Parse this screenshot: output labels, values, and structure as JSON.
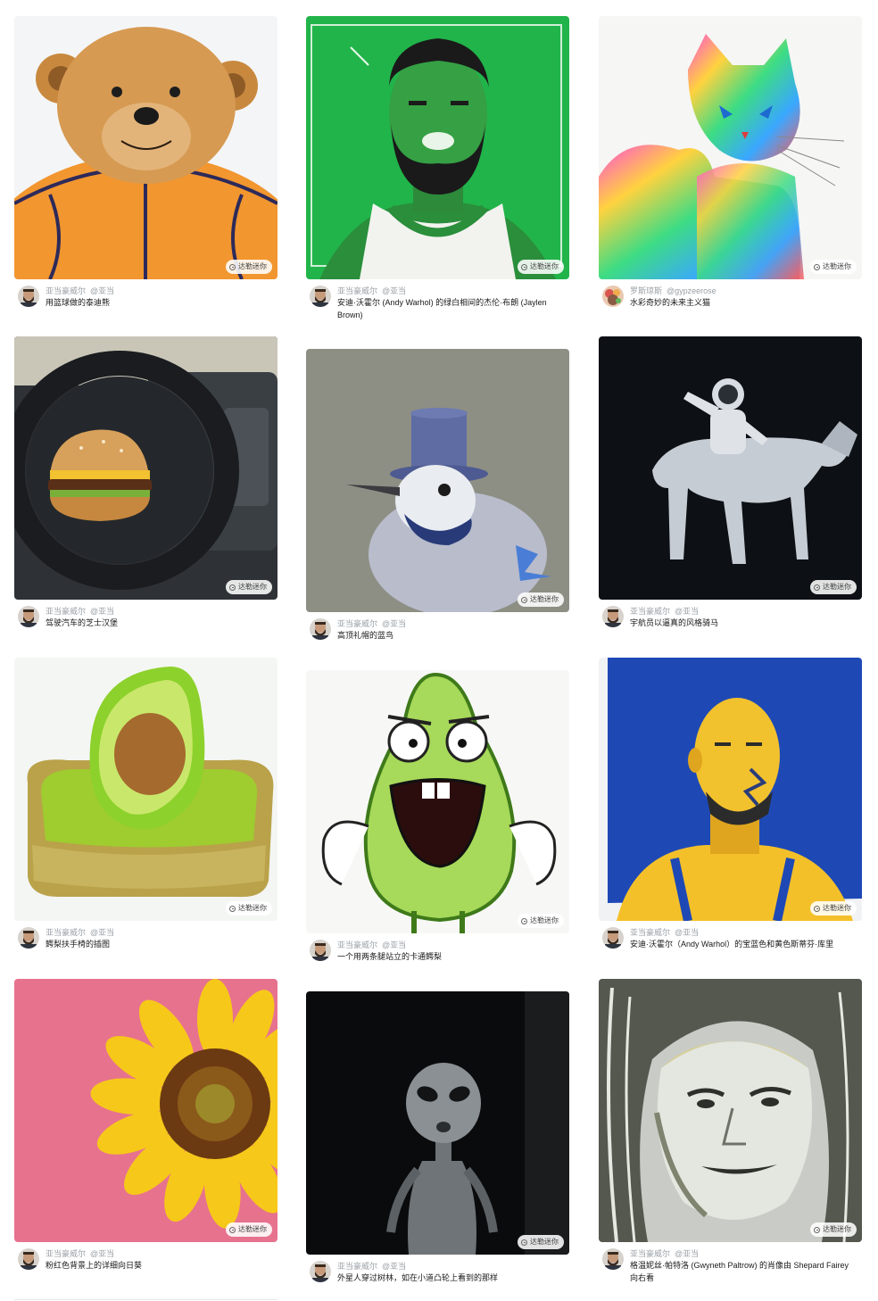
{
  "badge_label": "达勒迷你",
  "cards": [
    {
      "author": "亚当豪威尔",
      "handle": "@亚当",
      "caption": "用篮球做的泰迪熊",
      "image_icon": "teddy-bear-basketball",
      "avatar_icon": "bearded-man-avatar"
    },
    {
      "author": "亚当豪威尔",
      "handle": "@亚当",
      "caption": "安迪·沃霍尔 (Andy Warhol) 的绿白相间的杰伦·布朗 (Jaylen Brown)",
      "image_icon": "green-portrait",
      "avatar_icon": "bearded-man-avatar"
    },
    {
      "author": "罗斯琼斯",
      "handle": "@gypzeerose",
      "caption": "水彩奇妙的未来主义猫",
      "image_icon": "rainbow-cat",
      "avatar_icon": "floral-avatar"
    },
    {
      "author": "亚当豪威尔",
      "handle": "@亚当",
      "caption": "驾驶汽车的芝士汉堡",
      "image_icon": "burger-steering-wheel",
      "avatar_icon": "bearded-man-avatar"
    },
    {
      "author": "亚当豪威尔",
      "handle": "@亚当",
      "caption": "高顶礼帽的蓝鸟",
      "image_icon": "bluejay-top-hat",
      "avatar_icon": "bearded-man-avatar"
    },
    {
      "author": "亚当豪威尔",
      "handle": "@亚当",
      "caption": "宇航员以逼真的风格骑马",
      "image_icon": "astronaut-horse",
      "avatar_icon": "bearded-man-avatar"
    },
    {
      "author": "亚当豪威尔",
      "handle": "@亚当",
      "caption": "鳄梨扶手椅的插图",
      "image_icon": "avocado-armchair",
      "avatar_icon": "bearded-man-avatar"
    },
    {
      "author": "亚当豪威尔",
      "handle": "@亚当",
      "caption": "一个用两条腿站立的卡通鳄梨",
      "image_icon": "cartoon-avocado",
      "avatar_icon": "bearded-man-avatar"
    },
    {
      "author": "亚当豪威尔",
      "handle": "@亚当",
      "caption": "安迪·沃霍尔（Andy Warhol）的宝蓝色和黄色斯蒂芬·库里",
      "image_icon": "blue-yellow-portrait",
      "avatar_icon": "bearded-man-avatar"
    },
    {
      "author": "亚当豪威尔",
      "handle": "@亚当",
      "caption": "粉红色背景上的详细向日葵",
      "image_icon": "sunflower",
      "avatar_icon": "bearded-man-avatar"
    },
    {
      "author": "亚当豪威尔",
      "handle": "@亚当",
      "caption": "外星人穿过树林，如在小道凸轮上看到的那样",
      "image_icon": "alien-woods",
      "avatar_icon": "bearded-man-avatar"
    },
    {
      "author": "亚当豪威尔",
      "handle": "@亚当",
      "caption": "格温妮丝·帕特洛 (Gwyneth Paltrow) 的肖像由 Shepard Fairey 向右看",
      "image_icon": "stylized-portrait",
      "avatar_icon": "bearded-man-avatar"
    }
  ]
}
